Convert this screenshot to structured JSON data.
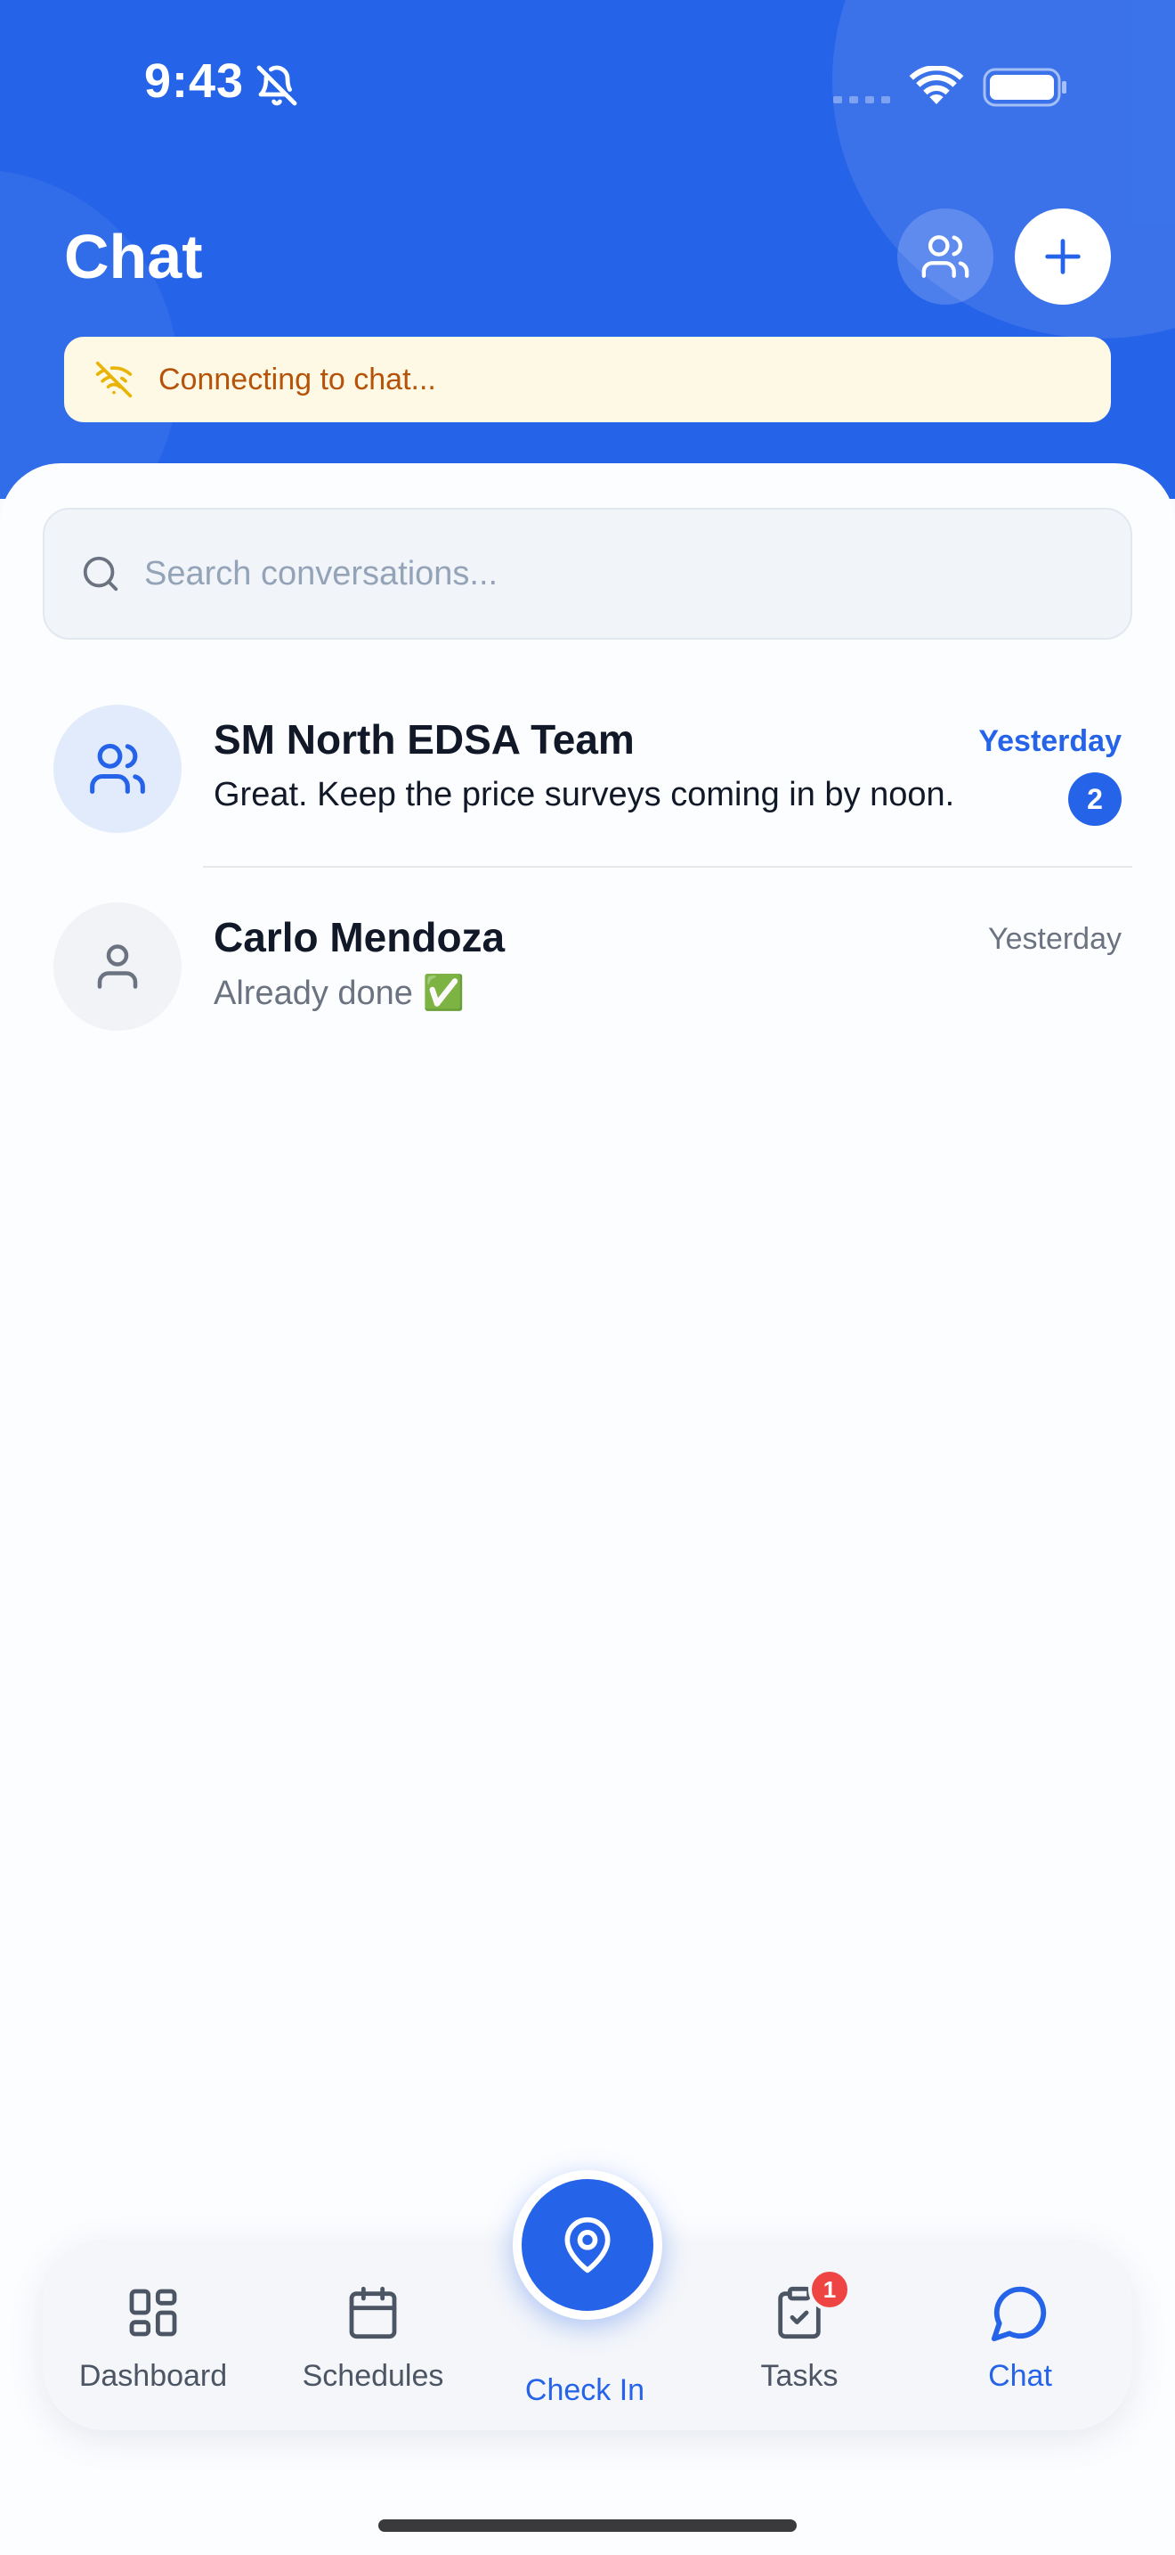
{
  "status_bar": {
    "time": "9:43"
  },
  "header": {
    "title": "Chat",
    "people_icon": "users-icon",
    "new_icon": "plus-icon"
  },
  "connection_banner": {
    "text": "Connecting to chat...",
    "icon": "wifi-off-icon"
  },
  "search": {
    "placeholder": "Search conversations..."
  },
  "conversations": [
    {
      "name": "SM North EDSA Team",
      "time": "Yesterday",
      "preview": "Great. Keep the price surveys coming in by noon.",
      "unread": "2",
      "avatar_icon": "group-icon"
    },
    {
      "name": "Carlo Mendoza",
      "time": "Yesterday",
      "preview": "Already done ✅",
      "avatar_icon": "user-icon"
    }
  ],
  "tabs": [
    {
      "label": "Dashboard",
      "icon": "grid-icon"
    },
    {
      "label": "Schedules",
      "icon": "calendar-icon"
    },
    {
      "label": "Check In",
      "icon": "map-pin-icon"
    },
    {
      "label": "Tasks",
      "icon": "clipboard-check-icon",
      "badge": "1"
    },
    {
      "label": "Chat",
      "icon": "chat-bubble-icon",
      "active": true
    }
  ],
  "colors": {
    "primary": "#2563e8",
    "banner_bg": "#fef9e4",
    "banner_text": "#b45309",
    "badge_red": "#ef4444"
  }
}
